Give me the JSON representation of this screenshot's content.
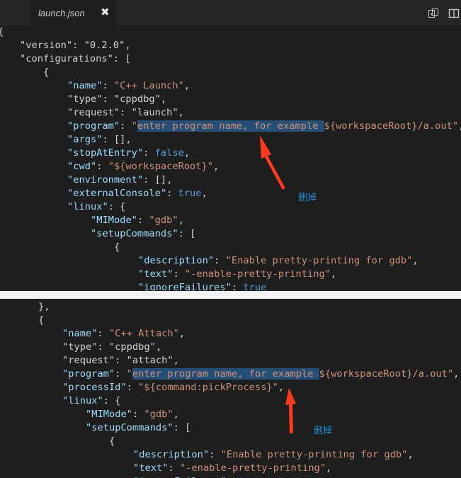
{
  "tab": {
    "filename": "launch.json",
    "close_glyph": "✖"
  },
  "icons": {
    "split_editor": "split-editor-icon",
    "open_changes": "open-changes-icon"
  },
  "code_top": [
    {
      "parts": [
        {
          "t": "{",
          "c": "p"
        }
      ]
    },
    {
      "parts": [
        {
          "t": "\"version\"",
          "c": "p"
        },
        {
          "t": ": ",
          "c": "p"
        },
        {
          "t": "\"0.2.0\"",
          "c": "p"
        },
        {
          "t": ",",
          "c": "p"
        }
      ]
    },
    {
      "parts": [
        {
          "t": "\"configurations\"",
          "c": "p"
        },
        {
          "t": ": [",
          "c": "p"
        }
      ]
    },
    {
      "parts": [
        {
          "t": "{",
          "c": "p"
        }
      ]
    },
    {
      "parts": [
        {
          "t": "\"name\"",
          "c": "k"
        },
        {
          "t": ": ",
          "c": "p"
        },
        {
          "t": "\"C++ Launch\"",
          "c": "s"
        },
        {
          "t": ",",
          "c": "p"
        }
      ]
    },
    {
      "parts": [
        {
          "t": "\"type\"",
          "c": "p"
        },
        {
          "t": ": ",
          "c": "p"
        },
        {
          "t": "\"cppdbg\"",
          "c": "p"
        },
        {
          "t": ",",
          "c": "p"
        }
      ]
    },
    {
      "parts": [
        {
          "t": "\"request\"",
          "c": "p"
        },
        {
          "t": ": ",
          "c": "p"
        },
        {
          "t": "\"launch\"",
          "c": "p"
        },
        {
          "t": ",",
          "c": "p"
        }
      ]
    },
    {
      "parts": [
        {
          "t": "\"program\"",
          "c": "k"
        },
        {
          "t": ": ",
          "c": "p"
        },
        {
          "t": "\"",
          "c": "s"
        },
        {
          "t": "enter program name, for example ",
          "c": "hl"
        },
        {
          "t": "${workspaceRoot}/a.out\"",
          "c": "s"
        },
        {
          "t": ",",
          "c": "p"
        }
      ]
    },
    {
      "parts": [
        {
          "t": "\"args\"",
          "c": "k"
        },
        {
          "t": ": [],",
          "c": "p"
        }
      ]
    },
    {
      "parts": [
        {
          "t": "\"stopAtEntry\"",
          "c": "k"
        },
        {
          "t": ": ",
          "c": "p"
        },
        {
          "t": "false",
          "c": "b"
        },
        {
          "t": ",",
          "c": "p"
        }
      ]
    },
    {
      "parts": [
        {
          "t": "\"cwd\"",
          "c": "k"
        },
        {
          "t": ": ",
          "c": "p"
        },
        {
          "t": "\"${workspaceRoot}\"",
          "c": "s"
        },
        {
          "t": ",",
          "c": "p"
        }
      ]
    },
    {
      "parts": [
        {
          "t": "\"environment\"",
          "c": "k"
        },
        {
          "t": ": [],",
          "c": "p"
        }
      ]
    },
    {
      "parts": [
        {
          "t": "\"externalConsole\"",
          "c": "k"
        },
        {
          "t": ": ",
          "c": "p"
        },
        {
          "t": "true",
          "c": "b"
        },
        {
          "t": ",",
          "c": "p"
        }
      ]
    },
    {
      "parts": [
        {
          "t": "\"linux\"",
          "c": "k"
        },
        {
          "t": ": {",
          "c": "p"
        }
      ]
    },
    {
      "parts": [
        {
          "t": "\"MIMode\"",
          "c": "k"
        },
        {
          "t": ": ",
          "c": "p"
        },
        {
          "t": "\"gdb\"",
          "c": "s"
        },
        {
          "t": ",",
          "c": "p"
        }
      ]
    },
    {
      "parts": [
        {
          "t": "\"setupCommands\"",
          "c": "k"
        },
        {
          "t": ": [",
          "c": "p"
        }
      ]
    },
    {
      "parts": [
        {
          "t": "{",
          "c": "p"
        }
      ]
    },
    {
      "parts": [
        {
          "t": "\"description\"",
          "c": "k"
        },
        {
          "t": ": ",
          "c": "p"
        },
        {
          "t": "\"Enable pretty-printing for gdb\"",
          "c": "s"
        },
        {
          "t": ",",
          "c": "p"
        }
      ]
    },
    {
      "parts": [
        {
          "t": "\"text\"",
          "c": "k"
        },
        {
          "t": ": ",
          "c": "p"
        },
        {
          "t": "\"-enable-pretty-printing\"",
          "c": "s"
        },
        {
          "t": ",",
          "c": "p"
        }
      ]
    },
    {
      "parts": [
        {
          "t": "\"ignoreFailures\"",
          "c": "k"
        },
        {
          "t": ": ",
          "c": "p"
        },
        {
          "t": "true",
          "c": "b"
        }
      ]
    },
    {
      "parts": [
        {
          "t": "}",
          "c": "p"
        }
      ]
    }
  ],
  "code_bottom": [
    {
      "parts": [
        {
          "t": "},",
          "c": "p"
        }
      ]
    },
    {
      "parts": [
        {
          "t": "{",
          "c": "p"
        }
      ]
    },
    {
      "parts": [
        {
          "t": "\"name\"",
          "c": "k"
        },
        {
          "t": ": ",
          "c": "p"
        },
        {
          "t": "\"C++ Attach\"",
          "c": "s"
        },
        {
          "t": ",",
          "c": "p"
        }
      ]
    },
    {
      "parts": [
        {
          "t": "\"type\"",
          "c": "p"
        },
        {
          "t": ": ",
          "c": "p"
        },
        {
          "t": "\"cppdbg\"",
          "c": "p"
        },
        {
          "t": ",",
          "c": "p"
        }
      ]
    },
    {
      "parts": [
        {
          "t": "\"request\"",
          "c": "p"
        },
        {
          "t": ": ",
          "c": "p"
        },
        {
          "t": "\"attach\"",
          "c": "p"
        },
        {
          "t": ",",
          "c": "p"
        }
      ]
    },
    {
      "parts": [
        {
          "t": "\"program\"",
          "c": "k"
        },
        {
          "t": ": ",
          "c": "p"
        },
        {
          "t": "\"",
          "c": "s"
        },
        {
          "t": "enter program name, for example ",
          "c": "hl"
        },
        {
          "t": "${workspaceRoot}/a.out\"",
          "c": "s"
        },
        {
          "t": ",",
          "c": "p"
        }
      ]
    },
    {
      "parts": [
        {
          "t": "\"processId\"",
          "c": "k"
        },
        {
          "t": ": ",
          "c": "p"
        },
        {
          "t": "\"${command:pickProcess}\"",
          "c": "s"
        },
        {
          "t": ",",
          "c": "p"
        }
      ]
    },
    {
      "parts": [
        {
          "t": "\"linux\"",
          "c": "k"
        },
        {
          "t": ": {",
          "c": "p"
        }
      ]
    },
    {
      "parts": [
        {
          "t": "\"MIMode\"",
          "c": "k"
        },
        {
          "t": ": ",
          "c": "p"
        },
        {
          "t": "\"gdb\"",
          "c": "s"
        },
        {
          "t": ",",
          "c": "p"
        }
      ]
    },
    {
      "parts": [
        {
          "t": "\"setupCommands\"",
          "c": "k"
        },
        {
          "t": ": [",
          "c": "p"
        }
      ]
    },
    {
      "parts": [
        {
          "t": "{",
          "c": "p"
        }
      ]
    },
    {
      "parts": [
        {
          "t": "\"description\"",
          "c": "k"
        },
        {
          "t": ": ",
          "c": "p"
        },
        {
          "t": "\"Enable pretty-printing for gdb\"",
          "c": "s"
        },
        {
          "t": ",",
          "c": "p"
        }
      ]
    },
    {
      "parts": [
        {
          "t": "\"text\"",
          "c": "k"
        },
        {
          "t": ": ",
          "c": "p"
        },
        {
          "t": "\"-enable-pretty-printing\"",
          "c": "s"
        },
        {
          "t": ",",
          "c": "p"
        }
      ]
    },
    {
      "parts": [
        {
          "t": "\"ignoreFailures\"",
          "c": "k"
        },
        {
          "t": ": ",
          "c": "p"
        },
        {
          "t": "true",
          "c": "b"
        }
      ]
    }
  ],
  "annotations": {
    "top": "删掉",
    "bottom": "删掉"
  }
}
